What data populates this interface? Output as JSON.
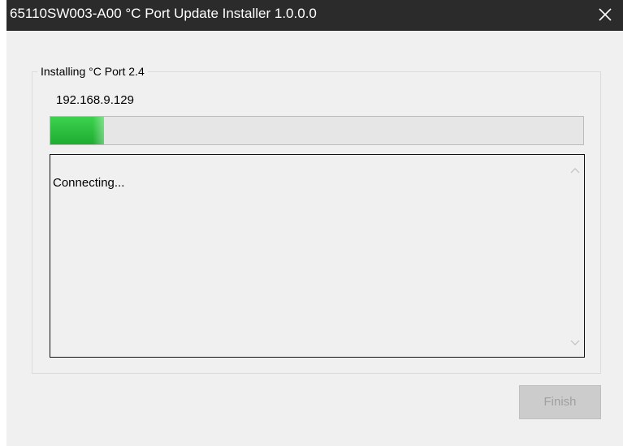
{
  "window": {
    "title": "65110SW003-A00 °C Port Update Installer 1.0.0.0",
    "close_icon": "close-icon"
  },
  "group": {
    "label": "Installing °C Port 2.4",
    "ip_address": "192.168.9.129"
  },
  "progress": {
    "value_percent": 10
  },
  "log": {
    "text": "Connecting..."
  },
  "buttons": {
    "finish_label": "Finish",
    "finish_enabled": false
  },
  "colors": {
    "titlebar": "#2b2b2b",
    "window_bg": "#f0f0f0",
    "progress_fill": "#2dbf40",
    "disabled_button_bg": "#cccccc",
    "disabled_button_text": "#a0a0a0"
  }
}
